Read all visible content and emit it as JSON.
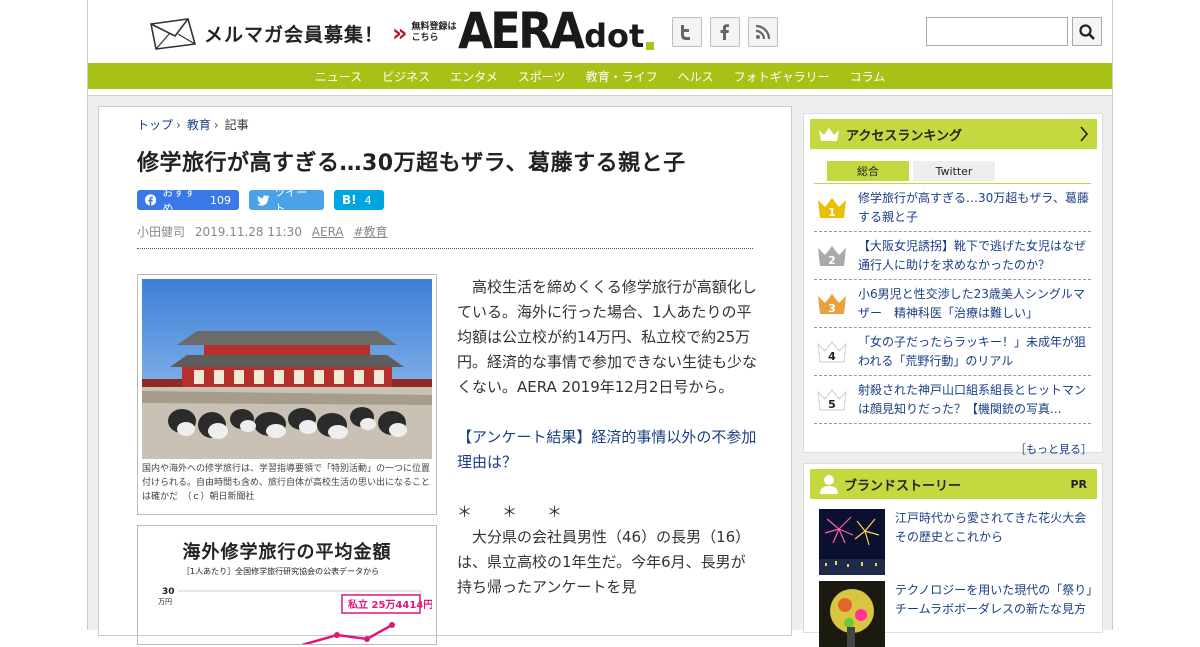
{
  "header": {
    "mailmag_label": "メルマガ会員募集！",
    "free_line1": "無料登録は",
    "free_line2": "こちら",
    "logo_main": "AERA",
    "logo_sub": "dot",
    "social_icons": [
      "twitter-icon",
      "facebook-icon",
      "rss-icon"
    ],
    "search_placeholder": ""
  },
  "nav": {
    "items": [
      "ニュース",
      "ビジネス",
      "エンタメ",
      "スポーツ",
      "教育・ライフ",
      "ヘルス",
      "フォトギャラリー",
      "コラム"
    ]
  },
  "article": {
    "breadcrumb": [
      "トップ",
      "教育",
      "記事"
    ],
    "title": "修学旅行が高すぎる…30万超もザラ、葛藤する親と子",
    "share": {
      "fb_label": "おすすめ",
      "fb_count": "109",
      "tw_label": "ツイート",
      "hb_label": "B!",
      "hb_count": "4"
    },
    "meta": {
      "author": "小田健司",
      "date": "2019.11.28 11:30",
      "source": "AERA",
      "tag": "#教育"
    },
    "photo_caption": "国内や海外への修学旅行は、学習指導要領で「特別活動」の一つに位置付けられる。自由時間も含め、旅行自体が高校生活の思い出になることは確かだ　（ｃ）朝日新聞社",
    "chart_title": "海外修学旅行の平均金額",
    "chart_sub": "［1人あたり］全国修学旅行研究協会の公表データから",
    "chart_axis_value": "30",
    "chart_axis_unit": "万円",
    "chart_label": "私立 25万4414円",
    "lead": "高校生活を締めくくる修学旅行が高額化している。海外に行った場合、1人あたりの平均額は公立校が約14万円、私立校で約25万円。経済的な事情で参加できない生徒も少なくない。AERA 2019年12月2日号から。",
    "link": "【アンケート結果】経済的事情以外の不参加理由は？",
    "stars": "＊　　＊　　＊",
    "body2": "大分県の会社員男性（46）の長男（16）は、県立高校の1年生だ。今年6月、長男が持ち帰ったアンケートを見"
  },
  "ranking": {
    "heading": "アクセスランキング",
    "tabs": [
      "総合",
      "Twitter"
    ],
    "items": [
      {
        "rank": "1",
        "text": "修学旅行が高すぎる…30万超もザラ、葛藤する親と子",
        "color": "#e8c000"
      },
      {
        "rank": "2",
        "text": "【大阪女児誘拐】靴下で逃げた女児はなぜ通行人に助けを求めなかったのか？",
        "color": "#aaaaaa"
      },
      {
        "rank": "3",
        "text": "小6男児と性交渉した23歳美人シングルマザー　精神科医「治療は難しい」",
        "color": "#e8a040"
      },
      {
        "rank": "4",
        "text": "「女の子だったらラッキー！」未成年が狙われる「荒野行動」のリアル",
        "color": "#ffffff"
      },
      {
        "rank": "5",
        "text": "射殺された神戸山口組系組長とヒットマンは顔見知りだった？【機関銃の写真...",
        "color": "#ffffff"
      }
    ],
    "more": "［もっと見る］"
  },
  "brand": {
    "heading": "ブランドストーリー",
    "pr": "PR",
    "items": [
      {
        "text": "江戸時代から愛されてきた花火大会　その歴史とこれから"
      },
      {
        "text": "テクノロジーを用いた現代の「祭り」チームラボボーダレスの新たな見方"
      }
    ]
  },
  "colors": {
    "nav_green": "#a9c017",
    "side_green": "#c5d840",
    "link_blue": "#1a3e85",
    "fb_blue": "#3b78e7",
    "tw_blue": "#4aa3e8",
    "hb_blue": "#00a4de",
    "mag_red": "#c8102e",
    "chart_pink": "#e0167f"
  }
}
